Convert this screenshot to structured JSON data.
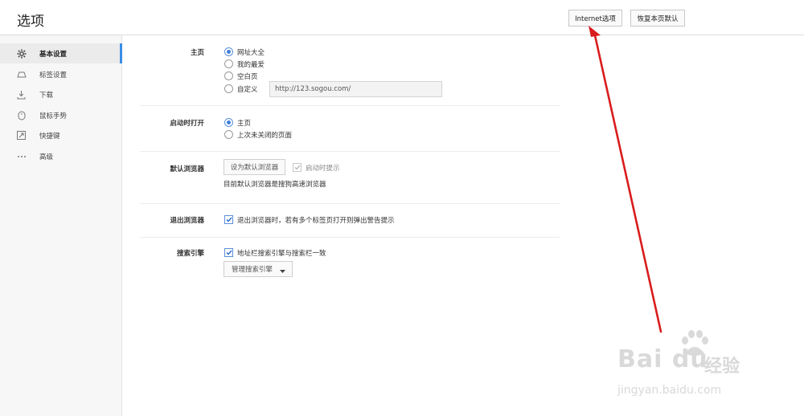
{
  "header": {
    "title": "选项",
    "internet_options_label": "Internet选项",
    "restore_defaults_label": "恢复本页默认"
  },
  "sidebar": {
    "items": [
      {
        "label": "基本设置",
        "icon": "gear-icon",
        "active": true
      },
      {
        "label": "标签设置",
        "icon": "tab-icon",
        "active": false
      },
      {
        "label": "下载",
        "icon": "download-icon",
        "active": false
      },
      {
        "label": "鼠标手势",
        "icon": "mouse-icon",
        "active": false
      },
      {
        "label": "快捷键",
        "icon": "shortcut-icon",
        "active": false
      },
      {
        "label": "高级",
        "icon": "more-icon",
        "active": false
      }
    ]
  },
  "homepage": {
    "label": "主页",
    "options": [
      "网址大全",
      "我的最爱",
      "空白页",
      "自定义"
    ],
    "selected": "网址大全",
    "custom_url": "http://123.sogou.com/"
  },
  "startup": {
    "label": "启动时打开",
    "options": [
      "主页",
      "上次未关闭的页面"
    ],
    "selected": "主页"
  },
  "default_browser": {
    "label": "默认浏览器",
    "set_default_label": "设为默认浏览器",
    "startup_prompt_label": "启动时提示",
    "status_text": "目前默认浏览器是搜狗高速浏览器"
  },
  "exit_browser": {
    "label": "退出浏览器",
    "warn_label": "退出浏览器时，若有多个标签页打开则弹出警告提示"
  },
  "search_engine": {
    "label": "搜索引擎",
    "sync_label": "地址栏搜索引擎与搜索栏一致",
    "manage_label": "管理搜索引擎"
  },
  "colors": {
    "accent": "#3a8ee6",
    "arrow": "#e01b1b"
  },
  "watermark": {
    "logo": "Bai du",
    "cn": "经验",
    "url": "jingyan.baidu.com"
  }
}
